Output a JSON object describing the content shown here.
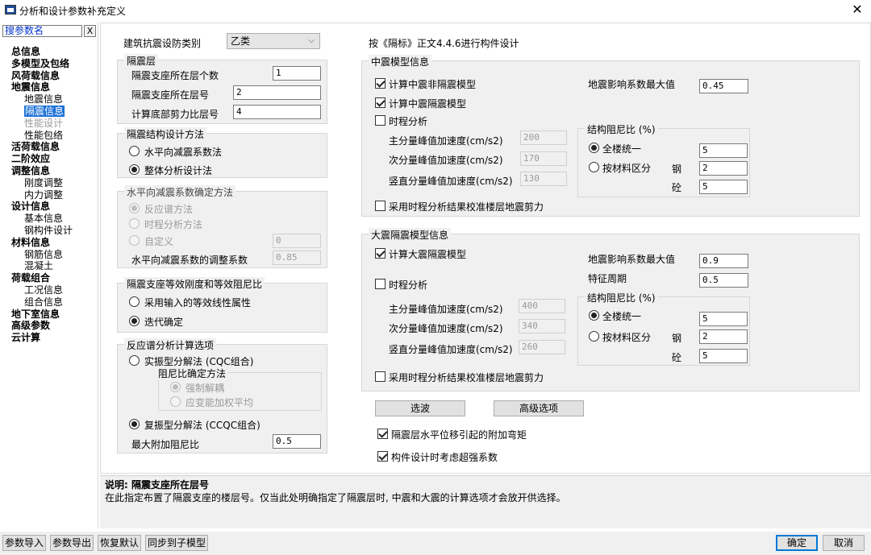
{
  "window": {
    "title": "分析和设计参数补充定义",
    "close": "✕"
  },
  "search": {
    "value": "搜参数名",
    "clear": "X"
  },
  "nav": [
    {
      "label": "总信息",
      "level": 0
    },
    {
      "label": "多模型及包络",
      "level": 0
    },
    {
      "label": "风荷载信息",
      "level": 0
    },
    {
      "label": "地震信息",
      "level": 0
    },
    {
      "label": "地震信息",
      "level": 1
    },
    {
      "label": "隔震信息",
      "level": 1,
      "selected": true
    },
    {
      "label": "性能设计",
      "level": 1,
      "disabled": true
    },
    {
      "label": "性能包络",
      "level": 1
    },
    {
      "label": "活荷载信息",
      "level": 0
    },
    {
      "label": "二阶效应",
      "level": 0
    },
    {
      "label": "调整信息",
      "level": 0
    },
    {
      "label": "刚度调整",
      "level": 1
    },
    {
      "label": "内力调整",
      "level": 1
    },
    {
      "label": "设计信息",
      "level": 0
    },
    {
      "label": "基本信息",
      "level": 1
    },
    {
      "label": "钢构件设计",
      "level": 1
    },
    {
      "label": "材料信息",
      "level": 0
    },
    {
      "label": "钢筋信息",
      "level": 1
    },
    {
      "label": "混凝土",
      "level": 1
    },
    {
      "label": "荷载组合",
      "level": 0
    },
    {
      "label": "工况信息",
      "level": 1
    },
    {
      "label": "组合信息",
      "level": 1
    },
    {
      "label": "地下室信息",
      "level": 0
    },
    {
      "label": "高级参数",
      "level": 0
    },
    {
      "label": "云计算",
      "level": 0
    }
  ],
  "left": {
    "category_label": "建筑抗震设防类别",
    "category_value": "乙类",
    "iso_layer": {
      "title": "隔震层",
      "count_label": "隔震支座所在层个数",
      "count_value": "1",
      "floor_label": "隔震支座所在层号",
      "floor_value": "2",
      "shear_label": "计算底部剪力比层号",
      "shear_value": "4"
    },
    "design_method": {
      "title": "隔震结构设计方法",
      "opt1": "水平向减震系数法",
      "opt2": "整体分析设计法"
    },
    "reduction": {
      "title": "水平向减震系数确定方法",
      "opt1": "反应谱方法",
      "opt2": "时程分析方法",
      "opt3": "自定义",
      "custom_value": "0",
      "adjust_label": "水平向减震系数的调整系数",
      "adjust_value": "0.85"
    },
    "stiffness": {
      "title": "隔震支座等效刚度和等效阻尼比",
      "opt1": "采用输入的等效线性属性",
      "opt2": "迭代确定"
    },
    "spectrum": {
      "title": "反应谱分析计算选项",
      "opt1": "实振型分解法 (CQC组合)",
      "damping_title": "阻尼比确定方法",
      "damp1": "强制解耦",
      "damp2": "应变能加权平均",
      "opt2": "复振型分解法 (CCQC组合)",
      "max_damping_label": "最大附加阻尼比",
      "max_damping_value": "0.5"
    }
  },
  "right": {
    "header": "按《隔标》正文4.4.6进行构件设计",
    "mid": {
      "title": "中震模型信息",
      "chk1": "计算中震非隔震模型",
      "chk2": "计算中震隔震模型",
      "chk3": "时程分析",
      "coef_label": "地震影响系数最大值",
      "coef_value": "0.45",
      "main_acc_label": "主分量峰值加速度(cm/s2)",
      "main_acc_value": "200",
      "sec_acc_label": "次分量峰值加速度(cm/s2)",
      "sec_acc_value": "170",
      "vert_acc_label": "竖直分量峰值加速度(cm/s2)",
      "vert_acc_value": "130",
      "damp_title": "结构阻尼比 (%)",
      "damp_opt1": "全楼统一",
      "damp_opt2": "按材料区分",
      "steel_label": "钢",
      "concrete_label": "砼",
      "uniform_value": "5",
      "steel_value": "2",
      "concrete_value": "5",
      "calibrate": "采用时程分析结果校准楼层地震剪力"
    },
    "large": {
      "title": "大震隔震模型信息",
      "chk1": "计算大震隔震模型",
      "chk2": "时程分析",
      "coef_label": "地震影响系数最大值",
      "coef_value": "0.9",
      "period_label": "特征周期",
      "period_value": "0.5",
      "main_acc_label": "主分量峰值加速度(cm/s2)",
      "main_acc_value": "400",
      "sec_acc_label": "次分量峰值加速度(cm/s2)",
      "sec_acc_value": "340",
      "vert_acc_label": "竖直分量峰值加速度(cm/s2)",
      "vert_acc_value": "260",
      "damp_title": "结构阻尼比 (%)",
      "damp_opt1": "全楼统一",
      "damp_opt2": "按材料区分",
      "steel_label": "钢",
      "concrete_label": "砼",
      "uniform_value": "5",
      "steel_value": "2",
      "concrete_value": "5",
      "calibrate": "采用时程分析结果校准楼层地震剪力"
    },
    "select_wave": "选波",
    "advanced": "高级选项",
    "extra_moment": "隔震层水平位移引起的附加弯矩",
    "overstrength": "构件设计时考虑超强系数"
  },
  "description": {
    "title": "说明: 隔震支座所在层号",
    "text": "在此指定布置了隔震支座的楼层号。仅当此处明确指定了隔震层时, 中震和大震的计算选项才会放开供选择。"
  },
  "footer": {
    "import": "参数导入",
    "export": "参数导出",
    "restore": "恢复默认",
    "sync": "同步到子模型",
    "ok": "确定",
    "cancel": "取消"
  }
}
